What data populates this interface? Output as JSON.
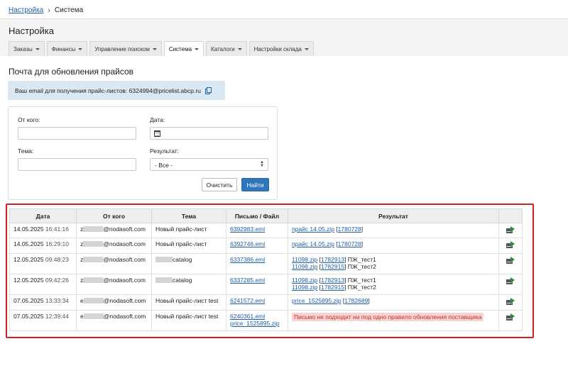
{
  "breadcrumb": {
    "parent": "Настройка",
    "current": "Система"
  },
  "page": {
    "title": "Настройка"
  },
  "tabs": [
    {
      "label": "Заказы",
      "active": false
    },
    {
      "label": "Финансы",
      "active": false
    },
    {
      "label": "Управление поиском",
      "active": false
    },
    {
      "label": "Система",
      "active": true
    },
    {
      "label": "Каталоги",
      "active": false
    },
    {
      "label": "Настройки склада",
      "active": false
    }
  ],
  "section": {
    "title": "Почта для обновления прайсов",
    "email_text": "Ваш email для получения прайс-листов: 6324994@pricelist.abcp.ru"
  },
  "filter": {
    "from_label": "От кого:",
    "from_value": "",
    "date_label": "Дата:",
    "date_value": "",
    "subject_label": "Тема:",
    "subject_value": "",
    "result_label": "Результат:",
    "result_value": "- Все -",
    "clear_label": "Очистить",
    "find_label": "Найти"
  },
  "table": {
    "headers": [
      "Дата",
      "От кого",
      "Тема",
      "Письмо / Файл",
      "Результат",
      ""
    ],
    "rows": [
      {
        "date": "14.05.2025",
        "time": "16:41:16",
        "from_prefix": "z",
        "from_domain": "@nodasoft.com",
        "subject": "Новый прайс-лист",
        "files": [
          "6392983.eml"
        ],
        "results": [
          {
            "file": "прайс 14.05.zip",
            "id": "1780728",
            "note": ""
          }
        ],
        "error": ""
      },
      {
        "date": "14.05.2025",
        "time": "16:29:10",
        "from_prefix": "z",
        "from_domain": "@nodasoft.com",
        "subject": "Новый прайс-лист",
        "files": [
          "6392746.eml"
        ],
        "results": [
          {
            "file": "прайс 14.05.zip",
            "id": "1780728",
            "note": ""
          }
        ],
        "error": ""
      },
      {
        "date": "12.05.2025",
        "time": "09:48:23",
        "from_prefix": "z",
        "from_domain": "@nodasoft.com",
        "subject": "catalog",
        "files": [
          "6337386.eml"
        ],
        "results": [
          {
            "file": "11098.zip",
            "id": "1782913",
            "note": "ПЖ_тест1"
          },
          {
            "file": "11098.zip",
            "id": "1782915",
            "note": "ПЖ_тест2"
          }
        ],
        "error": ""
      },
      {
        "date": "12.05.2025",
        "time": "09:42:26",
        "from_prefix": "z",
        "from_domain": "@nodasoft.com",
        "subject": "catalog",
        "files": [
          "6337285.eml"
        ],
        "results": [
          {
            "file": "11098.zip",
            "id": "1782913",
            "note": "ПЖ_тест1"
          },
          {
            "file": "11098.zip",
            "id": "1782915",
            "note": "ПЖ_тест2"
          }
        ],
        "error": ""
      },
      {
        "date": "07.05.2025",
        "time": "13:33:34",
        "from_prefix": "e",
        "from_domain": "@nodasoft.com",
        "subject": "Новый прайс-лист test",
        "files": [
          "6241572.eml"
        ],
        "results": [
          {
            "file": "price_1525895.zip",
            "id": "1782689",
            "note": ""
          }
        ],
        "error": ""
      },
      {
        "date": "07.05.2025",
        "time": "12:39:44",
        "from_prefix": "e",
        "from_domain": "@nodasoft.com",
        "subject": "Новый прайс-лист test",
        "files": [
          "6240361.eml",
          "price_1525895.zip"
        ],
        "results": [],
        "error": "Письмо не подходит ни под одно правило обновления поставщика"
      }
    ]
  }
}
